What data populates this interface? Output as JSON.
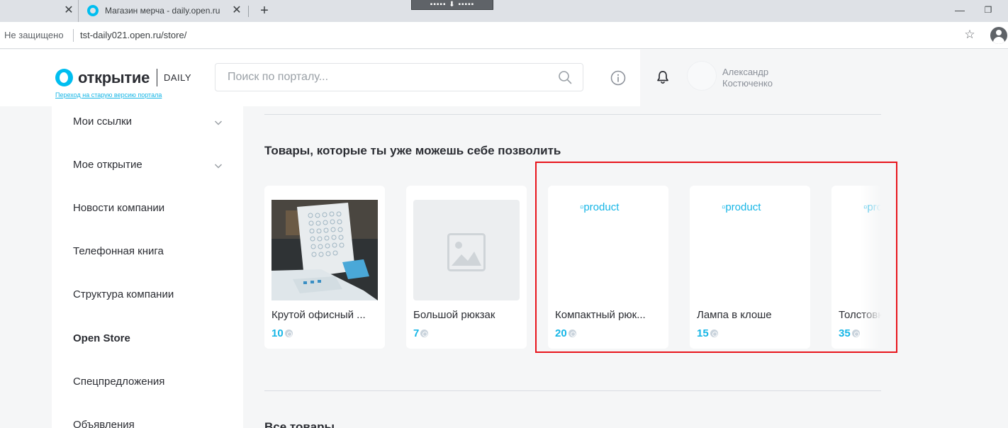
{
  "browser": {
    "tab_inactive_close": "✕",
    "tab_active_title": "Магазин мерча - daily.open.ru",
    "tab_active_close": "✕",
    "new_tab": "+",
    "remote_bar": "▪▪▪▪▪ ⬇ ▪▪▪▪▪",
    "minimize": "—",
    "restore": "❐",
    "security_label": "Не защищено",
    "url": "tst-daily021.open.ru/store/",
    "bookmark_star": "☆"
  },
  "header": {
    "logo_word": "открытие",
    "logo_suffix": "DAILY",
    "old_portal_link": "Переход на старую версию портала",
    "search_placeholder": "Поиск по порталу...",
    "user_name": "Александр Костюченко"
  },
  "sidebar": {
    "items": [
      {
        "label": "Мои ссылки",
        "has_chevron": true
      },
      {
        "label": "Мое открытие",
        "has_chevron": true
      },
      {
        "label": "Новости компании"
      },
      {
        "label": "Телефонная книга"
      },
      {
        "label": "Структура компании"
      },
      {
        "label": "Open Store",
        "active": true
      },
      {
        "label": "Спецпредложения"
      },
      {
        "label": "Объявления"
      }
    ]
  },
  "main": {
    "section_title": "Товары, которые ты уже можешь себе позволить",
    "next_section_title": "Все товары",
    "products": [
      {
        "name": "Крутой офисный ...",
        "price": "10",
        "image": "photo"
      },
      {
        "name": "Большой рюкзак",
        "price": "7",
        "image": "placeholder"
      },
      {
        "name": "Компактный рюк...",
        "price": "20",
        "image": "broken",
        "alt": "product"
      },
      {
        "name": "Лампа в клоше",
        "price": "15",
        "image": "broken",
        "alt": "product"
      },
      {
        "name": "Толстовка",
        "price": "35",
        "image": "broken",
        "alt": "product"
      }
    ]
  },
  "colors": {
    "accent": "#17b6e6",
    "brand": "#00bef0",
    "highlight": "#e8141c",
    "text": "#2b2d33"
  }
}
